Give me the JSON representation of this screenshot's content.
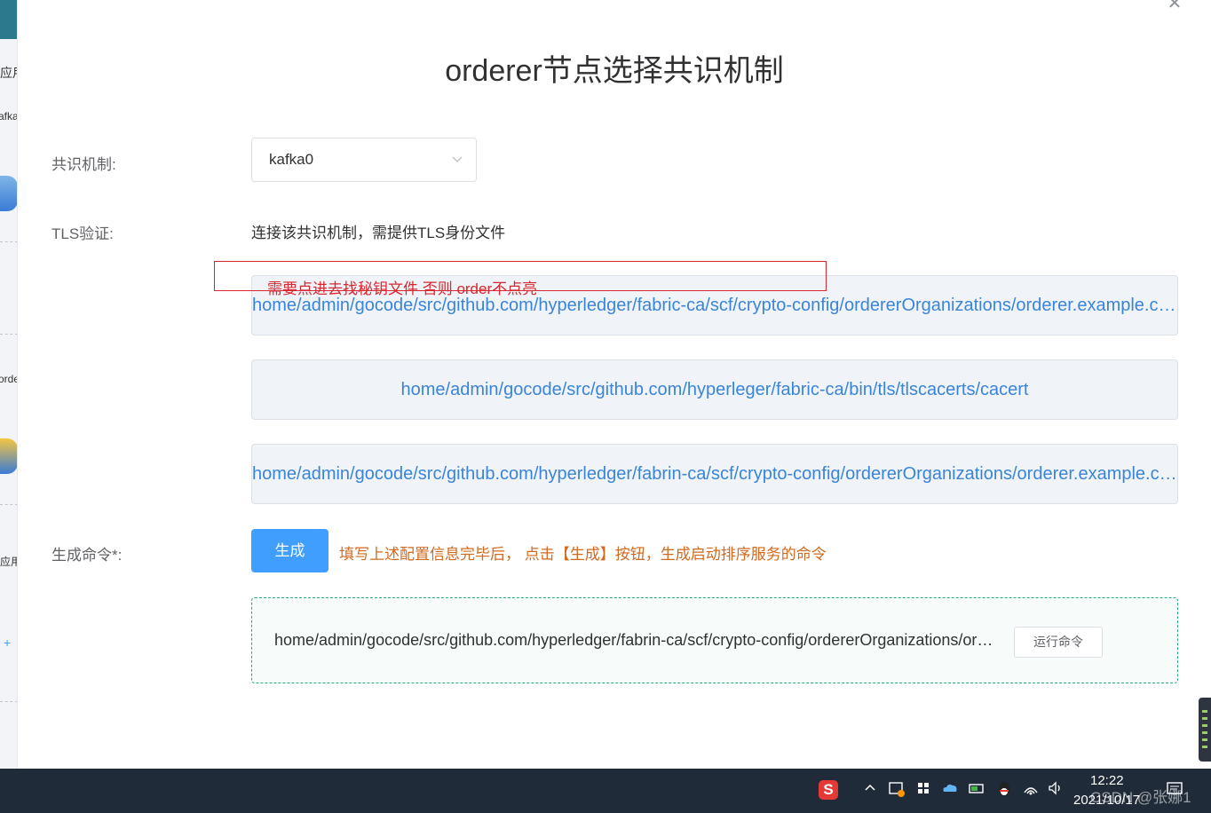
{
  "background": {
    "fragments": [
      "应用",
      "afka",
      "ordere",
      "应用",
      "+"
    ]
  },
  "modal": {
    "title": "orderer节点选择共识机制",
    "consensus_label": "共识机制:",
    "consensus_value": "kafka0",
    "tls_label": "TLS验证:",
    "tls_description": "连接该共识机制，需提供TLS身份文件",
    "annotation": "需要点进去找秘钥文件  否则 order不点亮",
    "files": [
      "home/admin/gocode/src/github.com/hyperledger/fabric-ca/scf/crypto-config/ordererOrganizations/orderer.example.com/orderers",
      "home/admin/gocode/src/github.com/hyperleger/fabric-ca/bin/tls/tlscacerts/cacert",
      "home/admin/gocode/src/github.com/hyperledger/fabrin-ca/scf/crypto-config/ordererOrganizations/orderer.example.com/orderers"
    ],
    "generate_label": "生成命令*:",
    "generate_button": "生成",
    "generate_hint": "填写上述配置信息完毕后， 点击【生成】按钮，生成启动排序服务的命令",
    "command_text": "home/admin/gocode/src/github.com/hyperledger/fabrin-ca/scf/crypto-config/ordererOrganizations/orderer.example.com",
    "run_button": "运行命令",
    "close_symbol": "✕"
  },
  "taskbar": {
    "time": "12:22",
    "date": "2021/10/17",
    "watermark": "CSDN @张娜1",
    "icons": [
      "sogou-ime-icon",
      "chevron-up-icon",
      "tray-app-icon",
      "windows-store-icon",
      "cloud-icon",
      "battery-icon",
      "qq-icon",
      "wifi-icon",
      "speaker-icon",
      "notification-icon"
    ]
  },
  "colors": {
    "primary": "#409eff",
    "link": "#3a85d9",
    "annotation": "#d9282f",
    "hint": "#d2691e",
    "command_border": "#2aa786"
  }
}
